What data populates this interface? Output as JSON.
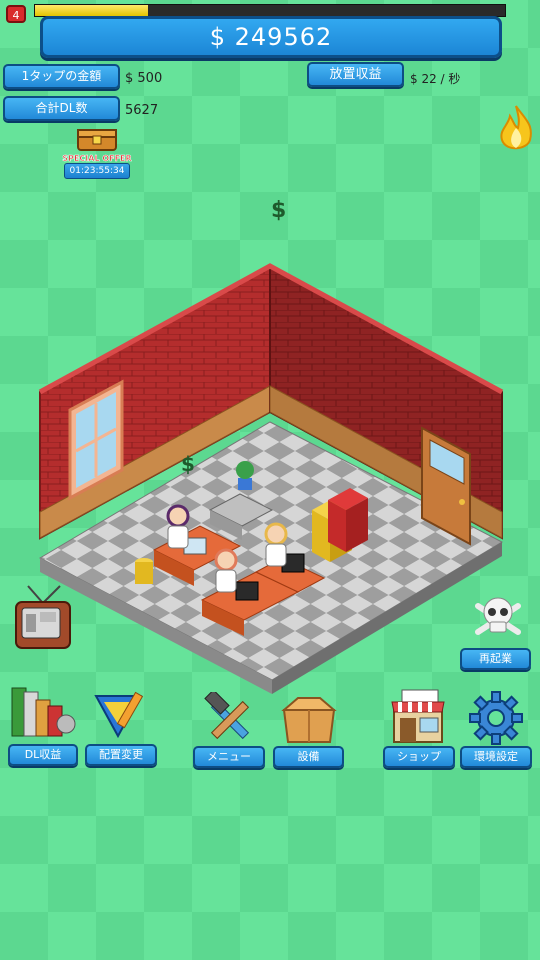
{
  "hud": {
    "level": "4",
    "progress": 0.24,
    "money": "$ 249562"
  },
  "stats": {
    "tap_label": "1タップの金額",
    "tap_value": "$ 500",
    "downloads_label": "合計DL数",
    "downloads_value": "5627",
    "idle_label": "放置収益",
    "idle_value": "$ 22 / 秒"
  },
  "special_offer": {
    "banner": "SPECIAL OFFER",
    "timer": "01:23:55:34"
  },
  "floating": {
    "dollar_top": "$",
    "dollar_room": "$"
  },
  "buttons": {
    "restart": "再起業",
    "dl_income": "DL収益",
    "layout": "配置変更",
    "menu": "メニュー",
    "equipment": "設備",
    "shop": "ショップ",
    "settings": "環境設定"
  },
  "colors": {
    "background": "#66e39a",
    "brick": "#b42d2d",
    "button_blue": "#2289d8"
  }
}
